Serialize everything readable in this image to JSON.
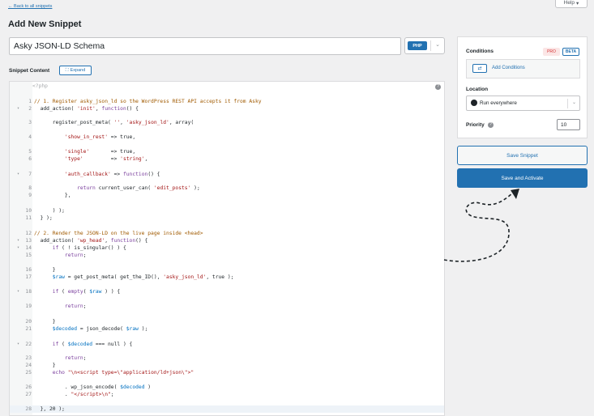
{
  "header": {
    "back_link": "← Back to all snippets",
    "help_label": "Help",
    "page_title": "Add New Snippet"
  },
  "snippet": {
    "title": "Asky JSON-LD Schema",
    "language": "PHP",
    "content_label": "Snippet Content",
    "expand_label": "Expand",
    "php_open_tag": "<?php"
  },
  "code_lines": [
    {
      "n": "1",
      "fold": "",
      "html": "<span class=\"c-comment\">// 1. Register asky_json_ld so the WordPress REST API accepts it from Asky</span>"
    },
    {
      "n": "2",
      "fold": "▾",
      "html": "  add_action( <span class=\"c-str\">'init'</span>, <span class=\"c-kw\">function</span>() {"
    },
    {
      "n": "3",
      "fold": "",
      "html": "      register_post_meta( <span class=\"c-str\">''</span>, <span class=\"c-str\">'asky_json_ld'</span>, array("
    },
    {
      "n": "4",
      "fold": "",
      "html": "          <span class=\"c-str\">'show_in_rest'</span> => true,"
    },
    {
      "n": "5",
      "fold": "",
      "html": "          <span class=\"c-str\">'single'</span>       => true,"
    },
    {
      "n": "6",
      "fold": "",
      "html": "          <span class=\"c-str\">'type'</span>         => <span class=\"c-str\">'string'</span>,"
    },
    {
      "n": "7",
      "fold": "▾",
      "html": "          <span class=\"c-str\">'auth_callback'</span> => <span class=\"c-kw\">function</span>() {"
    },
    {
      "n": "8",
      "fold": "",
      "html": "              <span class=\"c-kw\">return</span> current_user_can( <span class=\"c-str\">'edit_posts'</span> );"
    },
    {
      "n": "9",
      "fold": "",
      "html": "          },"
    },
    {
      "n": "10",
      "fold": "",
      "html": "      ) );"
    },
    {
      "n": "11",
      "fold": "",
      "html": "  } );"
    },
    {
      "n": "12",
      "fold": "",
      "html": "<span class=\"c-comment\">// 2. Render the JSON-LD on the live page inside &lt;head&gt;</span>"
    },
    {
      "n": "13",
      "fold": "▾",
      "html": "  add_action( <span class=\"c-str\">'wp_head'</span>, <span class=\"c-kw\">function</span>() {"
    },
    {
      "n": "14",
      "fold": "▾",
      "html": "      <span class=\"c-kw\">if</span> ( ! is_singular() ) {"
    },
    {
      "n": "15",
      "fold": "",
      "html": "          <span class=\"c-kw\">return</span>;"
    },
    {
      "n": "16",
      "fold": "",
      "html": "      }"
    },
    {
      "n": "17",
      "fold": "",
      "html": "      <span class=\"c-var\">$raw</span> = get_post_meta( get_the_ID(), <span class=\"c-str\">'asky_json_ld'</span>, true );"
    },
    {
      "n": "18",
      "fold": "▾",
      "html": "      <span class=\"c-kw\">if</span> ( <span class=\"c-kw\">empty</span>( <span class=\"c-var\">$raw</span> ) ) {"
    },
    {
      "n": "19",
      "fold": "",
      "html": "          <span class=\"c-kw\">return</span>;"
    },
    {
      "n": "20",
      "fold": "",
      "html": "      }"
    },
    {
      "n": "21",
      "fold": "",
      "html": "      <span class=\"c-var\">$decoded</span> = json_decode( <span class=\"c-var\">$raw</span> );"
    },
    {
      "n": "22",
      "fold": "▾",
      "html": "      <span class=\"c-kw\">if</span> ( <span class=\"c-var\">$decoded</span> === null ) {"
    },
    {
      "n": "23",
      "fold": "",
      "html": "          <span class=\"c-kw\">return</span>;"
    },
    {
      "n": "24",
      "fold": "",
      "html": "      }"
    },
    {
      "n": "25",
      "fold": "",
      "html": "      <span class=\"c-kw\">echo</span> <span class=\"c-str\">\"\\n&lt;script type=\\\"application/ld+json\\\"&gt;\"</span>"
    },
    {
      "n": "26",
      "fold": "",
      "html": "          . wp_json_encode( <span class=\"c-var\">$decoded</span> )"
    },
    {
      "n": "27",
      "fold": "",
      "html": "          . <span class=\"c-str\">\"&lt;/script&gt;\\n\"</span>;"
    },
    {
      "n": "28",
      "fold": "",
      "html": "  }, 20 );"
    }
  ],
  "sidebar": {
    "conditions_label": "Conditions",
    "pro_badge": "PRO",
    "beta_badge": "BETA",
    "add_conditions": "Add Conditions",
    "location_label": "Location",
    "location_value": "Run everywhere",
    "priority_label": "Priority",
    "priority_value": "10",
    "save_button": "Save Snippet",
    "save_activate_button": "Save and Activate"
  },
  "colors": {
    "accent": "#2271b1",
    "background": "#f0f0f1"
  }
}
